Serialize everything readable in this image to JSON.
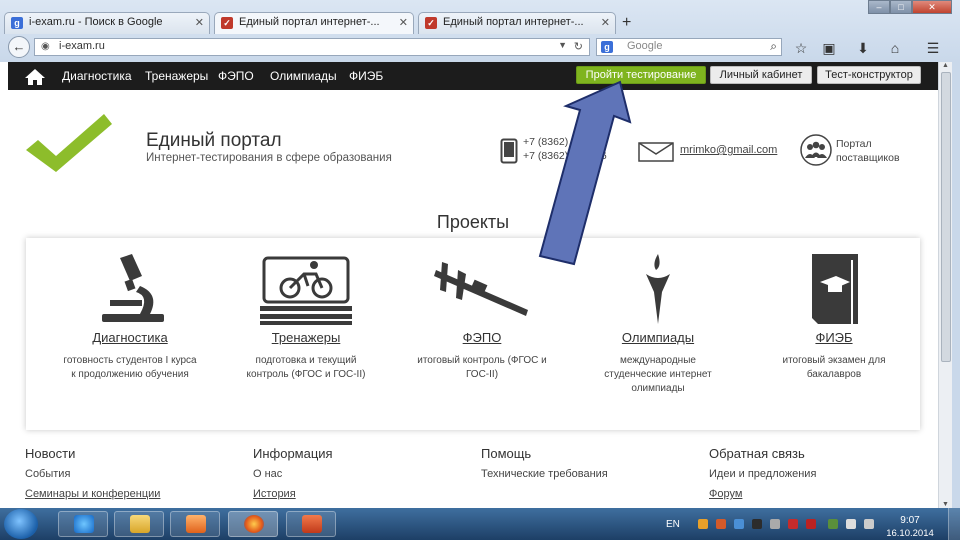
{
  "browser": {
    "tabs": [
      {
        "title": "i-exam.ru - Поиск в Google",
        "favicon": "google-favicon",
        "active": false
      },
      {
        "title": "Единый портал интернет-...",
        "favicon": "portal-favicon",
        "active": true
      },
      {
        "title": "Единый портал интернет-...",
        "favicon": "portal-favicon",
        "active": false
      }
    ],
    "new_tab": "+",
    "url": "i-exam.ru",
    "search_placeholder": "Google"
  },
  "site_nav": {
    "home_icon": "home-icon",
    "items": [
      "Диагностика",
      "Тренажеры",
      "ФЭПО",
      "Олимпиады",
      "ФИЭБ"
    ],
    "buttons": {
      "test": "Пройти тестирование",
      "cabinet": "Личный кабинет",
      "constructor": "Тест-конструктор"
    }
  },
  "header": {
    "title": "Единый портал",
    "subtitle": "Интернет-тестирования в сфере образования",
    "phones": [
      "+7 (8362) 6...-00",
      "+7 (8362) 6...4-66"
    ],
    "email": "mrimko@gmail.com",
    "suppliers": [
      "Портал",
      "поставщиков"
    ]
  },
  "projects": {
    "title": "Проекты",
    "items": [
      {
        "name": "Диагностика",
        "icon": "microscope-icon",
        "desc": "готовность студентов I курса к продолжению обучения"
      },
      {
        "name": "Тренажеры",
        "icon": "cyclist-icon",
        "desc": "подготовка и текущий контроль (ФГОС и ГОС-II)"
      },
      {
        "name": "ФЭПО",
        "icon": "caliper-icon",
        "desc": "итоговый контроль (ФГОС и ГОС-II)"
      },
      {
        "name": "Олимпиады",
        "icon": "flame-icon",
        "desc": "международные студенческие интернет олимпиады"
      },
      {
        "name": "ФИЭБ",
        "icon": "diploma-book-icon",
        "desc": "итоговый экзамен для бакалавров"
      }
    ]
  },
  "footer": {
    "columns": [
      {
        "heading": "Новости",
        "links": [
          "События",
          "Семинары и конференции"
        ]
      },
      {
        "heading": "Информация",
        "links": [
          "О нас",
          "История"
        ]
      },
      {
        "heading": "Помощь",
        "links": [
          "Технические требования",
          ""
        ]
      },
      {
        "heading": "Обратная связь",
        "links": [
          "Идеи и предложения",
          "Форум"
        ]
      }
    ]
  },
  "taskbar": {
    "lang": "EN",
    "time": "9:07",
    "date": "16.10.2014"
  },
  "colors": {
    "brand_green": "#7fb41f",
    "nav_bg": "#1c1c1c",
    "arrow": "#5f74b8"
  }
}
